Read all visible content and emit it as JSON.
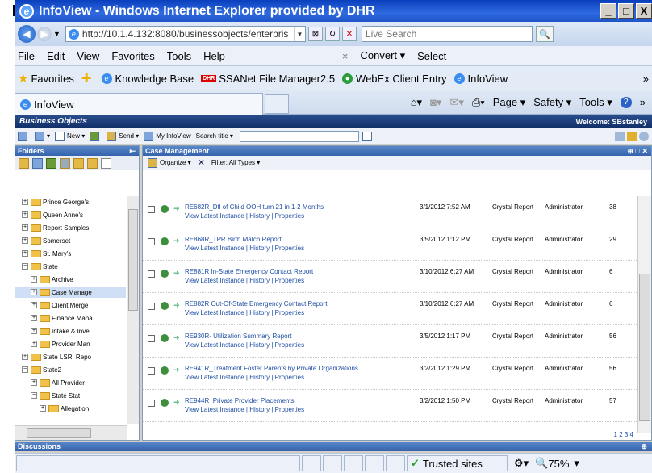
{
  "window": {
    "title": "InfoView - Windows Internet Explorer provided by DHR",
    "min": "_",
    "max": "□",
    "close": "X"
  },
  "address": {
    "url": "http://10.1.4.132:8080/businessobjects/enterpris",
    "search_placeholder": "Live Search"
  },
  "menu": [
    "File",
    "Edit",
    "View",
    "Favorites",
    "Tools",
    "Help"
  ],
  "menu_extra": {
    "x": "×",
    "convert": "Convert ▾",
    "select": "Select"
  },
  "favorites": {
    "label": "Favorites",
    "items": [
      "Knowledge Base",
      "SSANet File Manager2.5",
      "WebEx Client Entry",
      "InfoView"
    ],
    "dhr": "DHR",
    "more": "»"
  },
  "tab": {
    "label": "InfoView"
  },
  "commandbar": {
    "page": "Page ▾",
    "safety": "Safety ▾",
    "tools": "Tools ▾",
    "help": "?",
    "more": "»"
  },
  "app": {
    "brand": "Business Objects",
    "welcome": "Welcome: SBstanley"
  },
  "apptool": {
    "new": "New ▾",
    "send": "Send ▾",
    "myinfoview": "My InfoView",
    "searchtitle": "Search title ▾"
  },
  "folders": {
    "title": "Folders",
    "nodes": [
      {
        "label": "Prince George's",
        "pm": "+",
        "level": 2
      },
      {
        "label": "Queen Anne's",
        "pm": "+",
        "level": 2
      },
      {
        "label": "Report Samples",
        "pm": "+",
        "level": 2
      },
      {
        "label": "Somerset",
        "pm": "+",
        "level": 2
      },
      {
        "label": "St. Mary's",
        "pm": "+",
        "level": 2
      },
      {
        "label": "State",
        "pm": "−",
        "level": 2
      },
      {
        "label": "Archive",
        "pm": "+",
        "level": 3
      },
      {
        "label": "Case Manage",
        "pm": "+",
        "level": 3
      },
      {
        "label": "Client Merge",
        "pm": "+",
        "level": 3
      },
      {
        "label": "Finance Mana",
        "pm": "+",
        "level": 3
      },
      {
        "label": "Intake & Inve",
        "pm": "+",
        "level": 3
      },
      {
        "label": "Provider Man",
        "pm": "+",
        "level": 3
      },
      {
        "label": "State LSRI Repo",
        "pm": "+",
        "level": 2
      },
      {
        "label": "State2",
        "pm": "−",
        "level": 2
      },
      {
        "label": "All Provider",
        "pm": "+",
        "level": 3
      },
      {
        "label": "State Stat",
        "pm": "−",
        "level": 3
      },
      {
        "label": "Allegation",
        "pm": "+",
        "level": 4
      }
    ]
  },
  "case": {
    "title": "Case Management",
    "organize": "Organize ▾",
    "filter": "Filter: All Types ▾",
    "rows": [
      {
        "title": "RE682R_Dtl of Child OOH turn 21 in 1-2 Months",
        "links": "View Latest Instance | History | Properties",
        "date": "3/1/2012 7:52 AM",
        "type": "Crystal Report",
        "owner": "Administrator",
        "size": "38"
      },
      {
        "title": "RE868R_TPR Birth Match Report",
        "links": "View Latest Instance | History | Properties",
        "date": "3/5/2012 1:12 PM",
        "type": "Crystal Report",
        "owner": "Administrator",
        "size": "29"
      },
      {
        "title": "RE881R In-State Emergency Contact Report",
        "links": "View Latest Instance | History | Properties",
        "date": "3/10/2012 6:27 AM",
        "type": "Crystal Report",
        "owner": "Administrator",
        "size": "6"
      },
      {
        "title": "RE882R Out-Of-State Emergency Contact Report",
        "links": "View Latest Instance | History | Properties",
        "date": "3/10/2012 6:27 AM",
        "type": "Crystal Report",
        "owner": "Administrator",
        "size": "6"
      },
      {
        "title": "RE930R- Utilization Summary Report",
        "links": "View Latest Instance | History | Properties",
        "date": "3/5/2012 1:17 PM",
        "type": "Crystal Report",
        "owner": "Administrator",
        "size": "56"
      },
      {
        "title": "RE941R_Treatment Foster Parents by Private Organizations",
        "links": "View Latest Instance | History | Properties",
        "date": "3/2/2012 1:29 PM",
        "type": "Crystal Report",
        "owner": "Administrator",
        "size": "56"
      },
      {
        "title": "RE944R_Private Provider Placements",
        "links": "View Latest Instance | History | Properties",
        "date": "3/2/2012 1:50 PM",
        "type": "Crystal Report",
        "owner": "Administrator",
        "size": "57"
      }
    ],
    "pager": "1 2 3 4"
  },
  "discussions": {
    "title": "Discussions"
  },
  "status": {
    "trusted": "Trusted sites",
    "zoom": "75%"
  }
}
